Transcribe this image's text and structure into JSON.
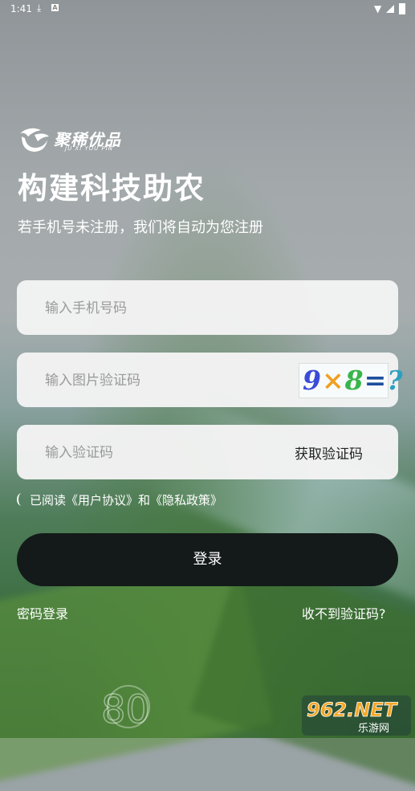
{
  "status_bar": {
    "time": "1:41"
  },
  "brand": {
    "name_cn": "聚稀优品",
    "name_en": "JU XI YOU PIN"
  },
  "headline": "构建科技助农",
  "subtitle": "若手机号未注册，我们将自动为您注册",
  "form": {
    "phone_placeholder": "输入手机号码",
    "image_code_placeholder": "输入图片验证码",
    "captcha_image_text": "9×8=?",
    "sms_code_placeholder": "输入验证码",
    "get_code_label": "获取验证码"
  },
  "agreement": {
    "text": "已阅读《用户协议》和《隐私政策》"
  },
  "login_button": "登录",
  "footer": {
    "password_login": "密码登录",
    "no_code": "收不到验证码?"
  },
  "watermark": {
    "top": "962.NET",
    "bottom": "乐游网"
  }
}
